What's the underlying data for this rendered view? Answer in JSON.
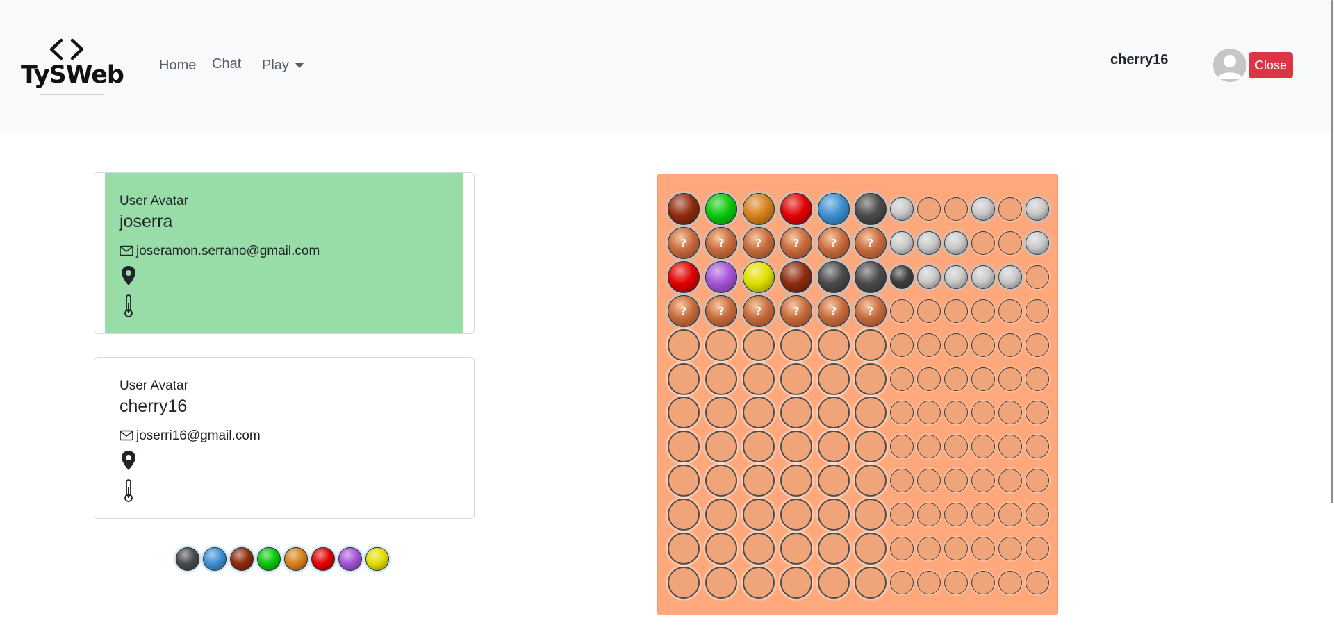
{
  "brand": {
    "name": "TySWeb"
  },
  "nav": {
    "home": "Home",
    "chat": "Chat",
    "play": "Play"
  },
  "user": {
    "username": "cherry16",
    "close_label": "Close"
  },
  "players": [
    {
      "avatar_label": "User Avatar",
      "name": "joserra",
      "email": "joseramon.serrano@gmail.com",
      "active": true
    },
    {
      "avatar_label": "User Avatar",
      "name": "cherry16",
      "email": "joserri16@gmail.com",
      "active": false
    }
  ],
  "colors": {
    "dark": "#4a4a4a",
    "blue": "#3d8fd2",
    "brown": "#8e2b0d",
    "green": "#0bc80b",
    "orange": "#d7811a",
    "red": "#e10000",
    "purple": "#a653d6",
    "yellow": "#e0df00",
    "peg_black": "#3f3f3f",
    "peg_white": "#c9c9c9",
    "board": "#ffa87b",
    "active_card": "#98dda8"
  },
  "palette": [
    "dark",
    "blue",
    "brown",
    "green",
    "orange",
    "red",
    "purple",
    "yellow"
  ],
  "board": {
    "rows": [
      {
        "balls": [
          "brown",
          "green",
          "orange",
          "red",
          "blue",
          "dark"
        ],
        "pegs": [
          "white",
          "empty",
          "empty",
          "white",
          "empty",
          "white"
        ]
      },
      {
        "balls": [
          "hidden",
          "hidden",
          "hidden",
          "hidden",
          "hidden",
          "hidden"
        ],
        "pegs": [
          "white",
          "white",
          "white",
          "empty",
          "empty",
          "white"
        ]
      },
      {
        "balls": [
          "red",
          "purple",
          "yellow",
          "brown",
          "dark",
          "dark"
        ],
        "pegs": [
          "black",
          "white",
          "white",
          "white",
          "white",
          "empty"
        ]
      },
      {
        "balls": [
          "hidden",
          "hidden",
          "hidden",
          "hidden",
          "hidden",
          "hidden"
        ],
        "pegs": [
          "empty",
          "empty",
          "empty",
          "empty",
          "empty",
          "empty"
        ]
      },
      {
        "balls": [
          "empty",
          "empty",
          "empty",
          "empty",
          "empty",
          "empty"
        ],
        "pegs": [
          "empty",
          "empty",
          "empty",
          "empty",
          "empty",
          "empty"
        ]
      },
      {
        "balls": [
          "empty",
          "empty",
          "empty",
          "empty",
          "empty",
          "empty"
        ],
        "pegs": [
          "empty",
          "empty",
          "empty",
          "empty",
          "empty",
          "empty"
        ]
      },
      {
        "balls": [
          "empty",
          "empty",
          "empty",
          "empty",
          "empty",
          "empty"
        ],
        "pegs": [
          "empty",
          "empty",
          "empty",
          "empty",
          "empty",
          "empty"
        ]
      },
      {
        "balls": [
          "empty",
          "empty",
          "empty",
          "empty",
          "empty",
          "empty"
        ],
        "pegs": [
          "empty",
          "empty",
          "empty",
          "empty",
          "empty",
          "empty"
        ]
      },
      {
        "balls": [
          "empty",
          "empty",
          "empty",
          "empty",
          "empty",
          "empty"
        ],
        "pegs": [
          "empty",
          "empty",
          "empty",
          "empty",
          "empty",
          "empty"
        ]
      },
      {
        "balls": [
          "empty",
          "empty",
          "empty",
          "empty",
          "empty",
          "empty"
        ],
        "pegs": [
          "empty",
          "empty",
          "empty",
          "empty",
          "empty",
          "empty"
        ]
      },
      {
        "balls": [
          "empty",
          "empty",
          "empty",
          "empty",
          "empty",
          "empty"
        ],
        "pegs": [
          "empty",
          "empty",
          "empty",
          "empty",
          "empty",
          "empty"
        ]
      },
      {
        "balls": [
          "empty",
          "empty",
          "empty",
          "empty",
          "empty",
          "empty"
        ],
        "pegs": [
          "empty",
          "empty",
          "empty",
          "empty",
          "empty",
          "empty"
        ]
      }
    ],
    "hidden_symbol": "?"
  }
}
